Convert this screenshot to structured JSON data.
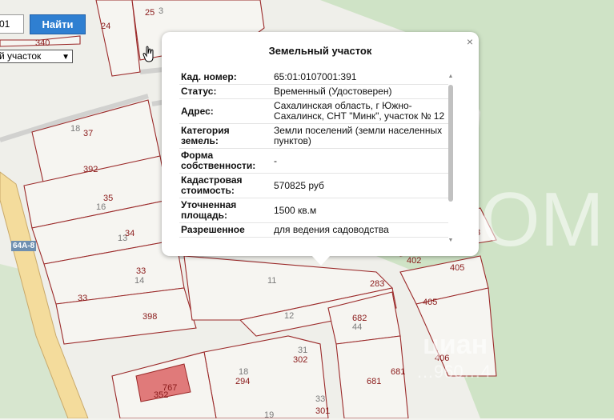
{
  "search": {
    "value": "01",
    "button_label": "Найти"
  },
  "object_type_select": {
    "value": "й участок"
  },
  "road_label": "64А-8",
  "map_labels": {
    "n25": "25",
    "n3": "3",
    "n24": "24",
    "n340": "340",
    "n18": "18",
    "n37": "37",
    "n392": "392",
    "n35": "35",
    "n16": "16",
    "n13": "13",
    "n34": "34",
    "n33a": "33",
    "n14": "14",
    "n33b": "33",
    "n398": "398",
    "n11": "11",
    "n12": "12",
    "n283": "283",
    "n402": "402",
    "n405a": "405",
    "n405b": "405",
    "n406": "406",
    "n682": "682",
    "n44": "44",
    "n681a": "681",
    "n681b": "681",
    "n31": "31",
    "n302": "302",
    "n18b": "18",
    "n294": "294",
    "n767": "767",
    "n352": "352",
    "n33c": "33",
    "n301": "301",
    "n19": "19",
    "n3b": "3"
  },
  "popup": {
    "title": "Земельный участок",
    "close": "×",
    "rows": [
      {
        "key": "Кад. номер:",
        "value": "65:01:0107001:391"
      },
      {
        "key": "Статус:",
        "value": "Временный (Удостоверен)"
      },
      {
        "key": "Адрес:",
        "value": "Сахалинская область, г Южно-Сахалинск, СНТ \"Минк\", участок № 12"
      },
      {
        "key": "Категория земель:",
        "value": "Земли поселений (земли населенных пунктов)"
      },
      {
        "key": "Форма собственности:",
        "value": "-"
      },
      {
        "key": "Кадастровая стоимость:",
        "value": "570825 руб"
      },
      {
        "key": "Уточненная площадь:",
        "value": "1500 кв.м"
      },
      {
        "key": "Разрешенное",
        "value": "для ведения садоводства"
      }
    ]
  },
  "watermark": {
    "brand": "циан",
    "phone": "…960…4",
    "big": "OM"
  },
  "colors": {
    "boundary": "#9b2a2a",
    "parcel_fill": "#f6f5f1",
    "forest": "#cfe3c6",
    "road": "#f3d48a",
    "highlight": "#e07a7a",
    "button": "#2f7fd1"
  }
}
